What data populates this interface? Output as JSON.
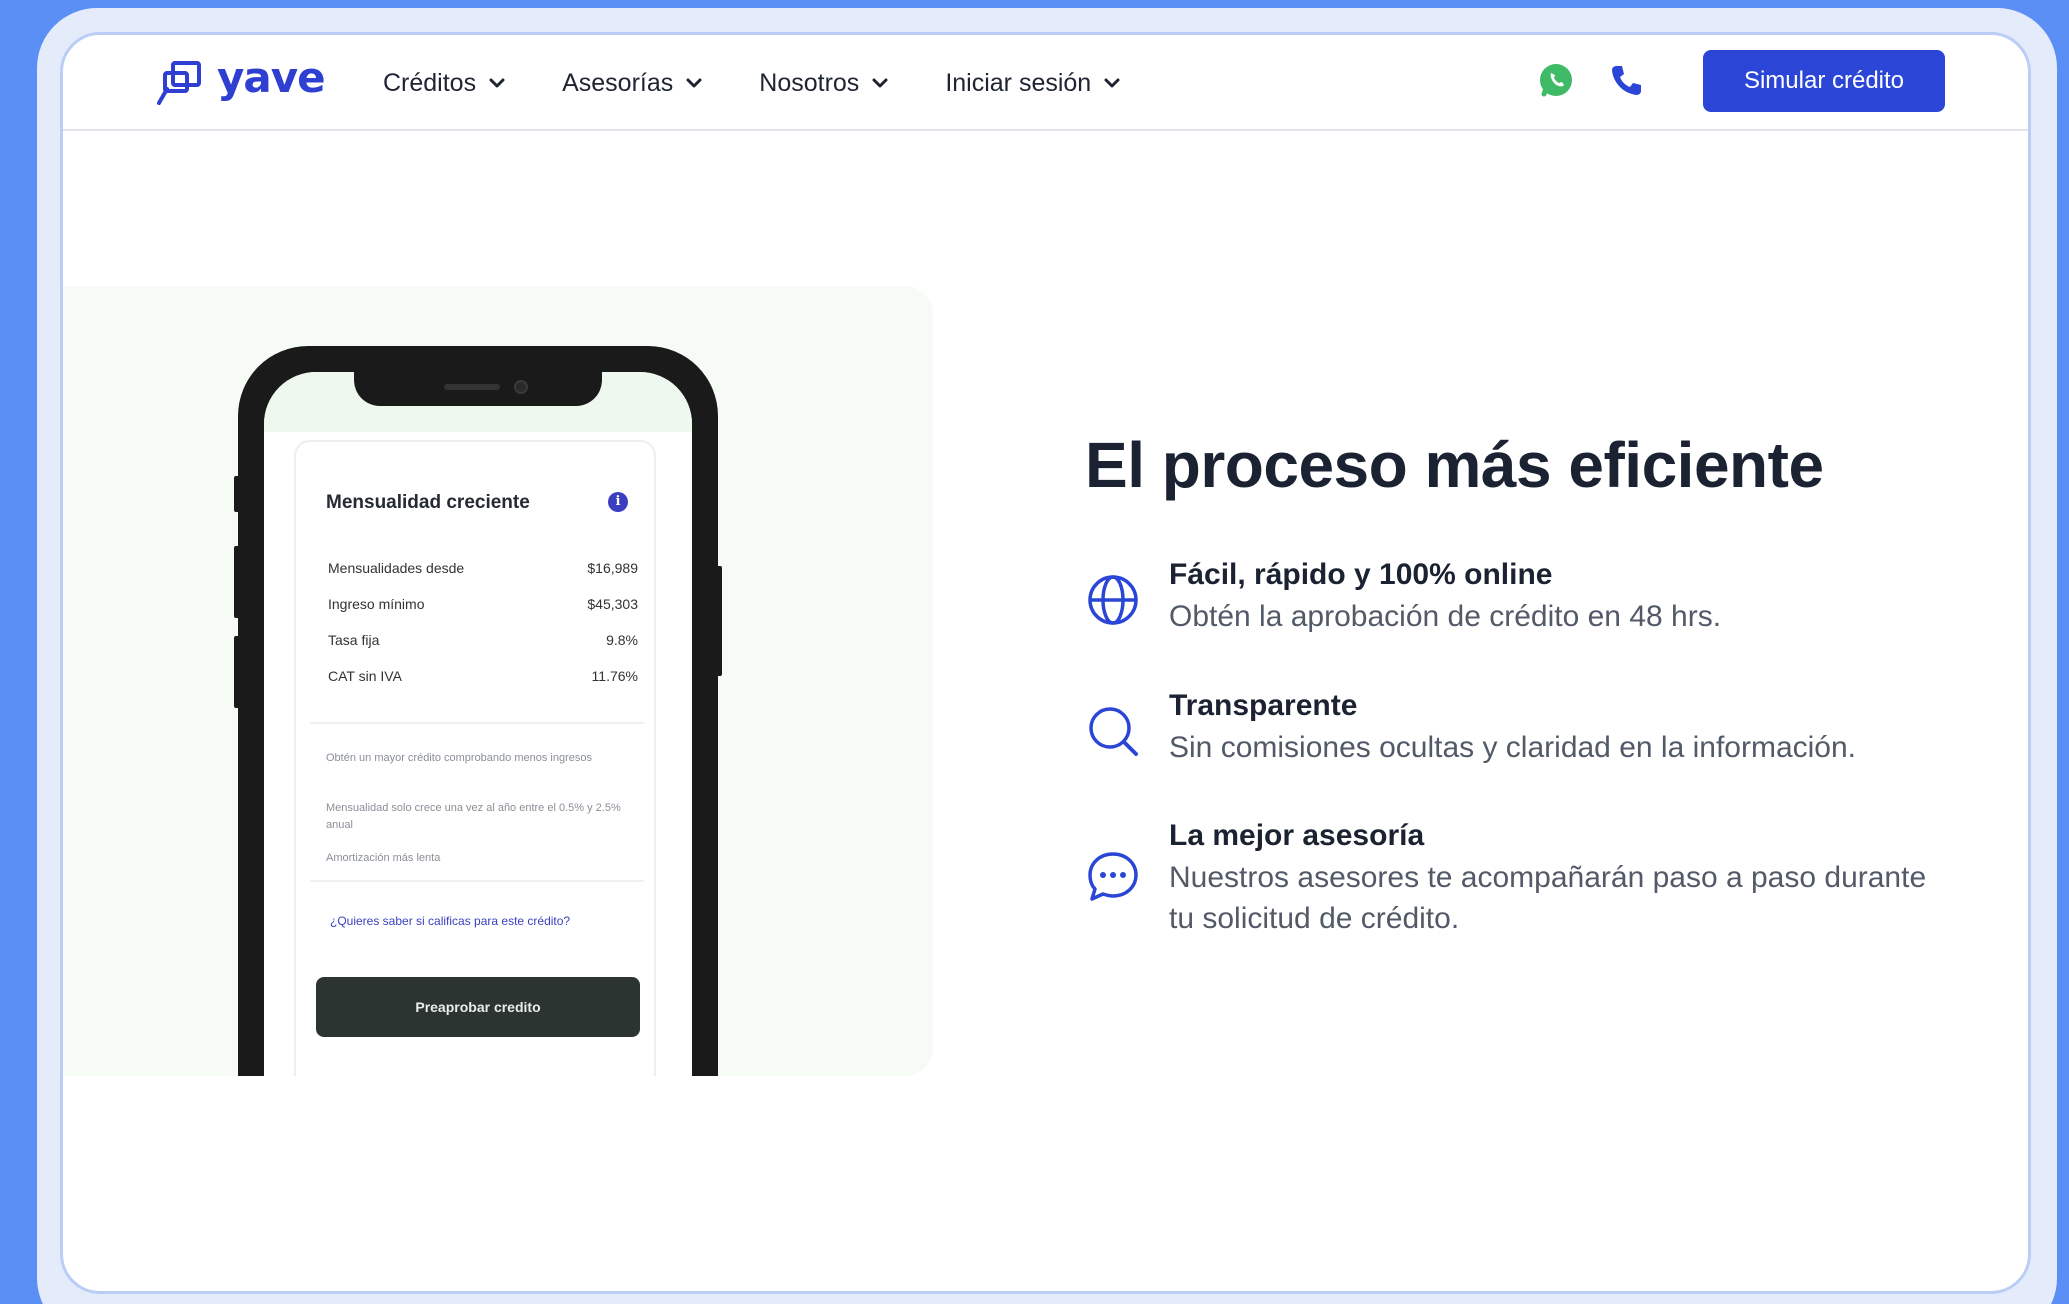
{
  "brand": {
    "name": "yave",
    "color": "#2e3fd1"
  },
  "nav": {
    "items": [
      {
        "label": "Créditos"
      },
      {
        "label": "Asesorías"
      },
      {
        "label": "Nosotros"
      },
      {
        "label": "Iniciar sesión"
      }
    ],
    "contact_icons": [
      "whatsapp-icon",
      "phone-icon"
    ],
    "cta_label": "Simular crédito"
  },
  "phone_card": {
    "title": "Mensualidad creciente",
    "rows": [
      {
        "label": "Mensualidades desde",
        "value": "$16,989"
      },
      {
        "label": "Ingreso mínimo",
        "value": "$45,303"
      },
      {
        "label": "Tasa fija",
        "value": "9.8%"
      },
      {
        "label": "CAT sin IVA",
        "value": "11.76%"
      }
    ],
    "notes": [
      "Obtén un mayor crédito comprobando menos ingresos",
      "Mensualidad solo crece una vez al año entre el 0.5% y 2.5% anual",
      "Amortización más lenta"
    ],
    "question": "¿Quieres saber si calificas para este crédito?",
    "button_label": "Preaprobar credito"
  },
  "section": {
    "headline": "El proceso más eficiente",
    "features": [
      {
        "icon": "globe-icon",
        "title": "Fácil, rápido y 100% online",
        "desc": "Obtén la aprobación de crédito en 48 hrs."
      },
      {
        "icon": "search-icon",
        "title": "Transparente",
        "desc": "Sin comisiones ocultas y claridad en la información."
      },
      {
        "icon": "chat-bubble-icon",
        "title": "La mejor asesoría",
        "desc": "Nuestros asesores te acompañarán paso a paso durante tu solicitud de crédito."
      }
    ]
  },
  "colors": {
    "accent": "#2b46d6",
    "background": "#5b8ff5",
    "whatsapp": "#3fba67"
  }
}
